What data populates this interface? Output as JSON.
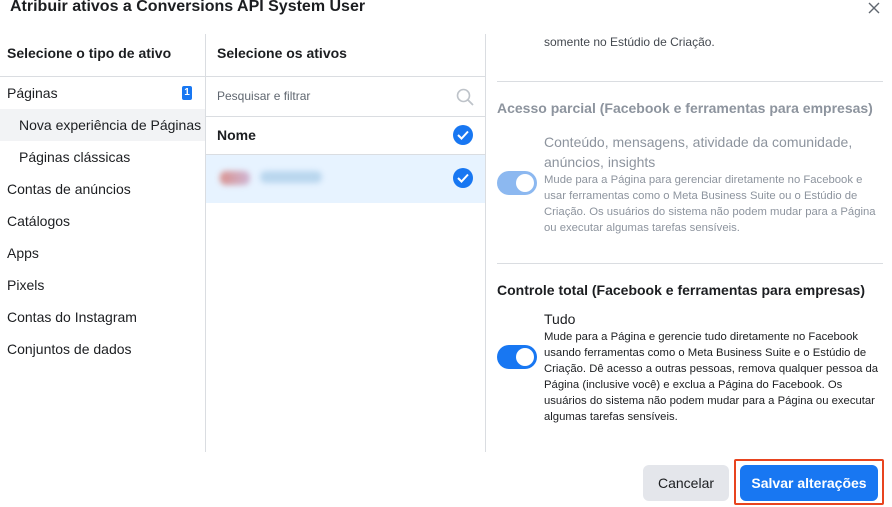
{
  "dialog": {
    "title": "Atribuir ativos a Conversions API System User"
  },
  "left_column": {
    "header": "Selecione o tipo de ativo",
    "items": [
      {
        "label": "Páginas",
        "badge": "1"
      },
      {
        "label": "Nova experiência de Páginas"
      },
      {
        "label": "Páginas clássicas"
      },
      {
        "label": "Contas de anúncios"
      },
      {
        "label": "Catálogos"
      },
      {
        "label": "Apps"
      },
      {
        "label": "Pixels"
      },
      {
        "label": "Contas do Instagram"
      },
      {
        "label": "Conjuntos de dados"
      }
    ]
  },
  "middle_column": {
    "header": "Selecione os ativos",
    "search_placeholder": "Pesquisar e filtrar",
    "name_header": "Nome",
    "asset_name": "Pagexamo"
  },
  "right_column": {
    "top_desc": "somente no Estúdio de Criação.",
    "partial": {
      "title": "Acesso parcial (Facebook e ferramentas para empresas)",
      "option_title": "Conteúdo, mensagens, atividade da comunidade, anúncios, insights",
      "option_desc": "Mude para a Página para gerenciar diretamente no Facebook e usar ferramentas como o Meta Business Suite ou o Estúdio de Criação. Os usuários do sistema não podem mudar para a Página ou executar algumas tarefas sensíveis."
    },
    "full": {
      "title": "Controle total (Facebook e ferramentas para empresas)",
      "option_title": "Tudo",
      "option_desc": "Mude para a Página e gerencie tudo diretamente no Facebook usando ferramentas como o Meta Business Suite e o Estúdio de Criação. Dê acesso a outras pessoas, remova qualquer pessoa da Página (inclusive você) e exclua a Página do Facebook. Os usuários do sistema não podem mudar para a Página ou executar algumas tarefas sensíveis."
    }
  },
  "footer": {
    "cancel_label": "Cancelar",
    "save_label": "Salvar alterações"
  },
  "colors": {
    "primary": "#1877f2",
    "highlight_border": "#e8441f",
    "selected_row": "#e7f3ff"
  }
}
